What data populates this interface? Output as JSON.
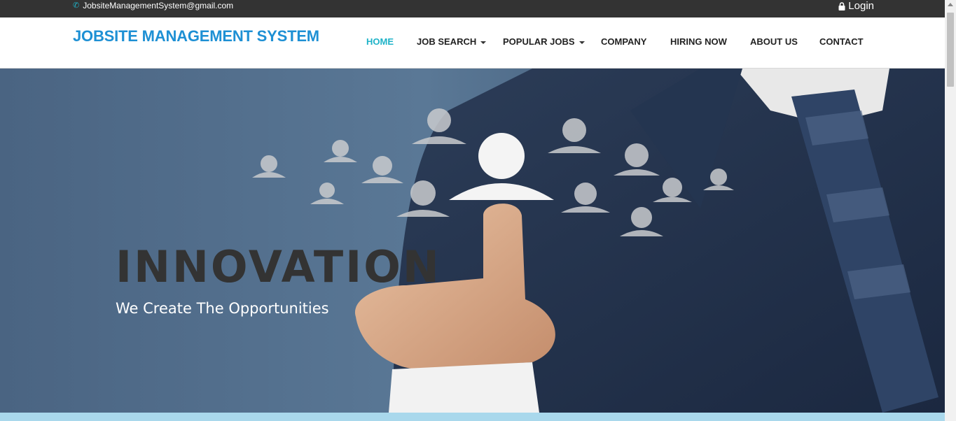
{
  "topbar": {
    "email": "JobsiteManagementSystem@gmail.com",
    "phone_icon": "phone-icon",
    "login_label": "Login",
    "login_icon": "lock-icon"
  },
  "navbar": {
    "brand": "JOBSITE MANAGEMENT SYSTEM",
    "items": [
      {
        "label": "HOME",
        "active": true
      },
      {
        "label": "JOB SEARCH",
        "dropdown": true
      },
      {
        "label": "POPULAR JOBS",
        "dropdown": true
      },
      {
        "label": "COMPANY"
      },
      {
        "label": "HIRING NOW"
      },
      {
        "label": "ABOUT US"
      },
      {
        "label": "CONTACT"
      }
    ]
  },
  "hero": {
    "title": "INNOVATION",
    "subtitle": "We Create The Opportunities"
  },
  "colors": {
    "accent": "#1fb3c8",
    "brand": "#1e90d4",
    "topbar": "#333333"
  }
}
